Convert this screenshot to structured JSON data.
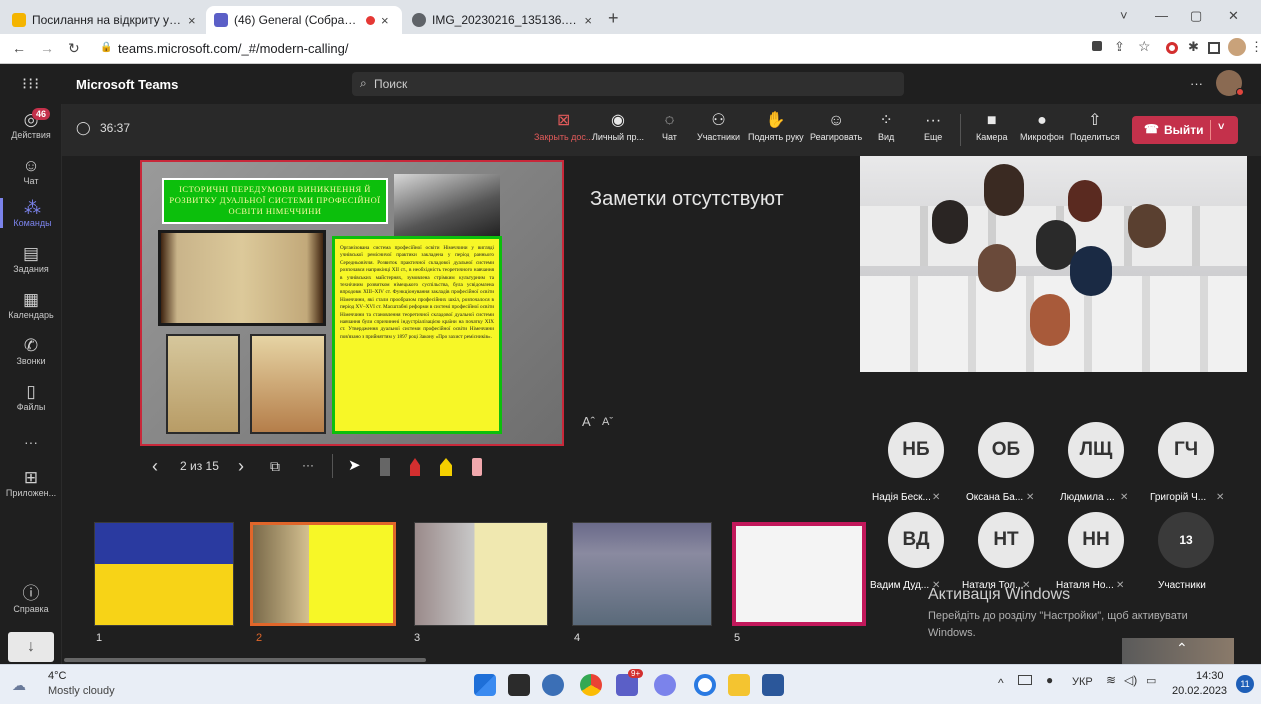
{
  "browser": {
    "tabs": [
      {
        "title": "Посилання на відкриту управлі",
        "close": "×"
      },
      {
        "title": "(46) General (Собрание) | M",
        "close": "×"
      },
      {
        "title": "IMG_20230216_135136.pdf",
        "close": "×"
      }
    ],
    "new_tab": "+",
    "url": "teams.microsoft.com/_#/modern-calling/",
    "window_controls": [
      "˅",
      "—",
      "▢",
      "✕"
    ]
  },
  "teams": {
    "app_name": "Microsoft Teams",
    "search_placeholder": "Поиск",
    "more": "···"
  },
  "rail": [
    {
      "label": "Действия",
      "icon": "bell-icon",
      "badge": "46"
    },
    {
      "label": "Чат",
      "icon": "chat-icon"
    },
    {
      "label": "Команды",
      "icon": "teams-icon"
    },
    {
      "label": "Задания",
      "icon": "assignments-icon"
    },
    {
      "label": "Календарь",
      "icon": "calendar-icon"
    },
    {
      "label": "Звонки",
      "icon": "calls-icon"
    },
    {
      "label": "Файлы",
      "icon": "files-icon"
    },
    {
      "label": "···",
      "icon": "more-icon"
    },
    {
      "label": "Приложен...",
      "icon": "apps-icon"
    },
    {
      "label": "Справка",
      "icon": "help-icon"
    }
  ],
  "meeting": {
    "timer": "36:37",
    "controls": [
      {
        "label": "Закрыть дос...",
        "icon": "stop-share-icon"
      },
      {
        "label": "Личный пр...",
        "icon": "private-view-icon"
      },
      {
        "label": "Чат",
        "icon": "chat-icon"
      },
      {
        "label": "Участники",
        "icon": "participants-icon"
      },
      {
        "label": "Поднять руку",
        "icon": "raise-hand-icon"
      },
      {
        "label": "Реагировать",
        "icon": "react-icon"
      },
      {
        "label": "Вид",
        "icon": "view-icon"
      },
      {
        "label": "Еще",
        "icon": "more-icon"
      },
      {
        "label": "Камера",
        "icon": "camera-icon"
      },
      {
        "label": "Микрофон",
        "icon": "mic-icon"
      },
      {
        "label": "Поделиться",
        "icon": "share-icon"
      }
    ],
    "leave_label": "Выйти"
  },
  "slide": {
    "title": "ІСТОРИЧНІ ПЕРЕДУМОВИ ВИНИКНЕННЯ Й РОЗВИТКУ ДУАЛЬНОЇ СИСТЕМИ ПРОФЕСІЙНОЇ ОСВІТИ НІМЕЧЧИНИ",
    "body": "Організована система професійної освіти Німеччини у вигляді учнівської ремісничої практики закладена у період раннього Середньовіччя. Розвиток практичної складової дуальної системи розпочався наприкінці XII ст., в необхідність теоретичного навчання в учнівських майстернях, зумовлена стрімким культурним та технічним розвитком німецького суспільства, була усвідомлена впродовж XIII–XIV ст. Функціонування закладів професійної освіти Німеччини, які стали прообразом професійних шкіл, розпочалося в період XV–XVI ст. Масштабні реформи в системі професійної освіти Німеччини та становлення теоретичної складової дуальної системи навчання були спричинені індустріалізацією країни на початку XIX ст. Утвердження дуальної системи професійної освіти Німеччини пов'язано з прийняттям у 1897 році Закону «Про захист ремісників»."
  },
  "slide_nav": {
    "counter": "2 из 15",
    "prev": "‹",
    "next": "›",
    "more": "···"
  },
  "notes": {
    "empty_text": "Заметки отсутствуют",
    "font_up": "Aˆ",
    "font_down": "Aˇ"
  },
  "participants": [
    {
      "initials": "НБ",
      "name": "Надія Беск...",
      "color": "#e8e8e8"
    },
    {
      "initials": "ОБ",
      "name": "Оксана Ба...",
      "color": "#e8e8e8"
    },
    {
      "initials": "ЛЩ",
      "name": "Людмила ...",
      "color": "#e8e8e8"
    },
    {
      "initials": "ГЧ",
      "name": "Григорій Ч...",
      "color": "#e8e8e8"
    },
    {
      "initials": "ВД",
      "name": "Вадим Дуд...",
      "color": "#e8e8e8"
    },
    {
      "initials": "НТ",
      "name": "Наталя Тол...",
      "color": "#e8e8e8"
    },
    {
      "initials": "НН",
      "name": "Наталя Но...",
      "color": "#e8e8e8"
    },
    {
      "initials": "13",
      "name": "Участники",
      "color": "#3a3a3a"
    }
  ],
  "thumbnails": [
    {
      "num": "1"
    },
    {
      "num": "2"
    },
    {
      "num": "3"
    },
    {
      "num": "4"
    },
    {
      "num": "5"
    }
  ],
  "watermark": {
    "title": "Активація Windows",
    "text": "Перейдіть до розділу \"Настройки\", щоб активувати Windows."
  },
  "taskbar": {
    "temp": "4°C",
    "weather": "Mostly cloudy",
    "lang": "УКР",
    "time": "14:30",
    "date": "20.02.2023",
    "notif": "11"
  },
  "colors": {
    "teams_accent": "#7b83eb",
    "leave_red": "#c4314b",
    "slide_green": "#0cbf0c",
    "slide_yellow": "#f7f727"
  }
}
